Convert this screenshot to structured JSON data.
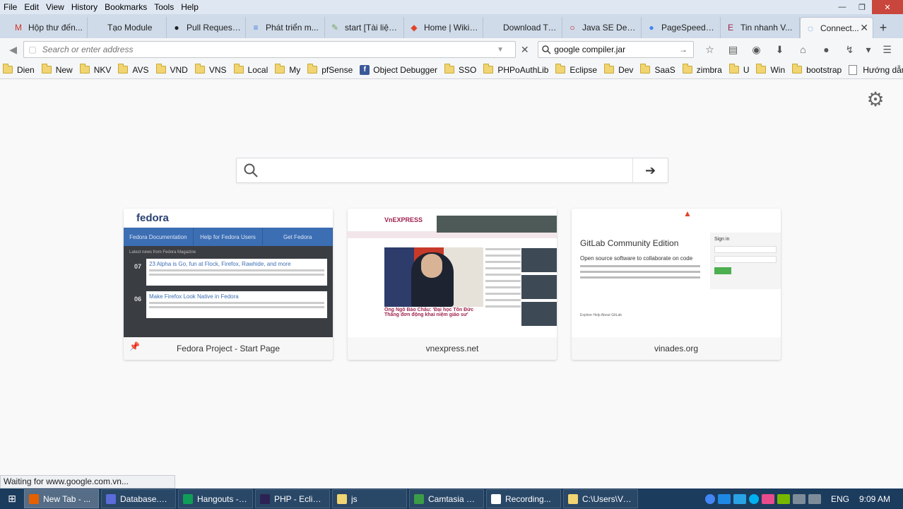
{
  "menu": [
    "File",
    "Edit",
    "View",
    "History",
    "Bookmarks",
    "Tools",
    "Help"
  ],
  "tabs": [
    {
      "label": "Hộp thư đến...",
      "icon": "gmail-icon",
      "color": "#d93025",
      "glyph": "M"
    },
    {
      "label": "Tạo Module",
      "icon": "blank-page-icon",
      "color": "#cfdbe9",
      "glyph": ""
    },
    {
      "label": "Pull Request...",
      "icon": "github-icon",
      "color": "#222222",
      "glyph": "●"
    },
    {
      "label": "Phát triển m...",
      "icon": "docs-icon",
      "color": "#4a7fdb",
      "glyph": "≡"
    },
    {
      "label": "start [Tài liệu...",
      "icon": "dokuwiki-icon",
      "color": "#7aa35a",
      "glyph": "✎"
    },
    {
      "label": "Home | Wiki ...",
      "icon": "gitlab-icon",
      "color": "#e24329",
      "glyph": "◆"
    },
    {
      "label": "Download Titani...",
      "icon": "blank-page-icon",
      "color": "#cfdbe9",
      "glyph": ""
    },
    {
      "label": "Java SE Devel...",
      "icon": "oracle-icon",
      "color": "#c4161c",
      "glyph": "○"
    },
    {
      "label": "PageSpeed I...",
      "icon": "google-icon",
      "color": "#4285f4",
      "glyph": "●"
    },
    {
      "label": "Tin nhanh V...",
      "icon": "news-icon",
      "color": "#9f224e",
      "glyph": "E"
    }
  ],
  "active_tab": {
    "label": "Connect...",
    "close": "✕"
  },
  "nav": {
    "url_placeholder": "Search or enter address",
    "search_value": "google compiler.jar"
  },
  "bookmarks": [
    {
      "label": "Dien",
      "type": "folder"
    },
    {
      "label": "New",
      "type": "folder"
    },
    {
      "label": "NKV",
      "type": "folder"
    },
    {
      "label": "AVS",
      "type": "folder"
    },
    {
      "label": "VND",
      "type": "folder"
    },
    {
      "label": "VNS",
      "type": "folder"
    },
    {
      "label": "Local",
      "type": "folder"
    },
    {
      "label": "My",
      "type": "folder"
    },
    {
      "label": "pfSense",
      "type": "folder"
    },
    {
      "label": "Object Debugger",
      "type": "facebook"
    },
    {
      "label": "SSO",
      "type": "folder"
    },
    {
      "label": "PHPoAuthLib",
      "type": "folder"
    },
    {
      "label": "Eclipse",
      "type": "folder"
    },
    {
      "label": "Dev",
      "type": "folder"
    },
    {
      "label": "SaaS",
      "type": "folder"
    },
    {
      "label": "zimbra",
      "type": "folder"
    },
    {
      "label": "U",
      "type": "folder"
    },
    {
      "label": "Win",
      "type": "folder"
    },
    {
      "label": "bootstrap",
      "type": "folder"
    },
    {
      "label": "Hướng dẫn tối ưu tấn...",
      "type": "page"
    }
  ],
  "tiles": [
    {
      "caption": "Fedora Project - Start Page",
      "fedora": {
        "logo": "fedora",
        "nav": [
          "Fedora Documentation",
          "Help for Fedora Users",
          "Get Fedora"
        ],
        "news_head": "Latest news from Fedora Magazine",
        "cards": [
          {
            "day": "07",
            "title": "23 Alpha is Go, fun at Flock, Firefox, Rawhide, and more"
          },
          {
            "day": "06",
            "title": "Make Firefox Look Native in Fedora"
          }
        ]
      }
    },
    {
      "caption": "vnexpress.net",
      "vne": {
        "logo": "VnEXPRESS",
        "headline": "Ông Ngô Bảo Châu: 'Đại học Tôn Đức Thắng đơn động khai niệm giáo sư'"
      }
    },
    {
      "caption": "vinades.org",
      "gitlab": {
        "title": "GitLab Community Edition",
        "subtitle": "Open source software to collaborate on code",
        "signin": "Sign in",
        "footer": "Explore   Help   About GitLab"
      }
    }
  ],
  "status": "Waiting for www.google.com.vn...",
  "taskbar": [
    {
      "label": "New Tab - ...",
      "color": "#e66000",
      "active": true
    },
    {
      "label": "Database.kd...",
      "color": "#5b6bd8",
      "active": false
    },
    {
      "label": "Hangouts - t...",
      "color": "#0f9d58",
      "active": false
    },
    {
      "label": "PHP - Eclipse",
      "color": "#2c2255",
      "active": false
    },
    {
      "label": "js",
      "color": "#f1d572",
      "active": false
    },
    {
      "label": "Camtasia St...",
      "color": "#3a9d46",
      "active": false
    },
    {
      "label": "Recording...",
      "color": "#ffffff",
      "active": false
    },
    {
      "label": "C:\\Users\\Vu...",
      "color": "#f1d572",
      "active": false
    }
  ],
  "tray": {
    "lang": "ENG",
    "time": "9:09 AM"
  }
}
